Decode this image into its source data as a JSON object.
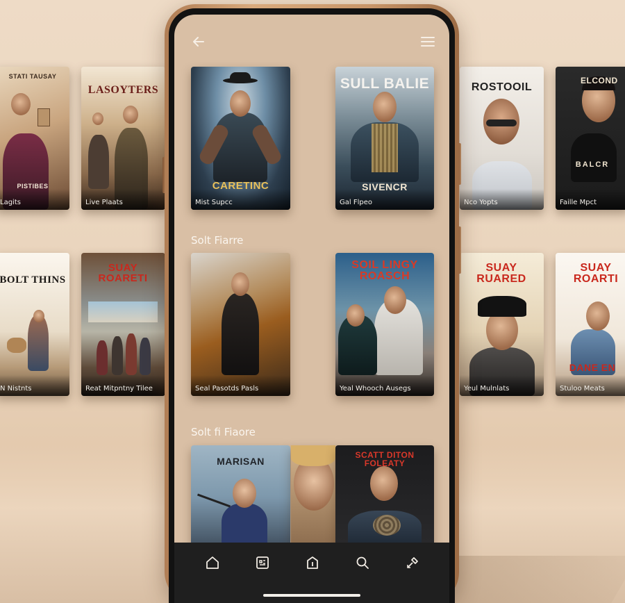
{
  "screen": {
    "back_icon": "arrow-left-icon",
    "menu_icon": "hamburger-menu-icon",
    "sections": [
      {
        "label": ""
      },
      {
        "label": "Solt Fiarre"
      },
      {
        "label": "Solt fi Fiaore"
      }
    ],
    "posters": [
      {
        "title": "CARETINC",
        "caption": "Mist Supcc"
      },
      {
        "title": "SULL BALIE",
        "subtitle": "SIVENCR",
        "caption": "Gal Flpeo"
      },
      {
        "caption": "Seal Pasotds Pasls"
      },
      {
        "title": "SOIL LINGY ROASCH",
        "caption": "Yeal Whooch Ausegs"
      },
      {
        "title": "MARISAN"
      },
      {
        "title": "SCATT DITON FOLEATY"
      }
    ],
    "tabs": [
      {
        "name": "home-icon"
      },
      {
        "name": "grid-icon"
      },
      {
        "name": "info-icon"
      },
      {
        "name": "search-icon"
      },
      {
        "name": "tools-icon"
      }
    ]
  },
  "background_posters": [
    {
      "title": "STATI TAUSAY",
      "subtitle": "PISTIBES",
      "caption": "Lagits"
    },
    {
      "title": "LASOYTERS",
      "caption": "Live Plaats"
    },
    {
      "title": "ROSTOOIL",
      "caption": "Nco Yopts"
    },
    {
      "title": "ELCOND",
      "subtitle": "BALCR",
      "caption": "Faille Mpct"
    },
    {
      "title": "BOLT THINS",
      "caption": "N Nistnts"
    },
    {
      "title": "SUAY ROARETI",
      "caption": "Reat Mitpntny Tilee"
    },
    {
      "title": "SUAY RUARED",
      "caption": "Yeul Mulnlats"
    },
    {
      "title": "SUAY ROARTI",
      "subtitle": "DANE EN",
      "caption": "Stuloo Meats"
    }
  ],
  "colors": {
    "background": "#eedbc6",
    "screen_bg": "#d9bfa5",
    "phone_frame": "#c89569",
    "tabbar": "#1f1f1f"
  }
}
